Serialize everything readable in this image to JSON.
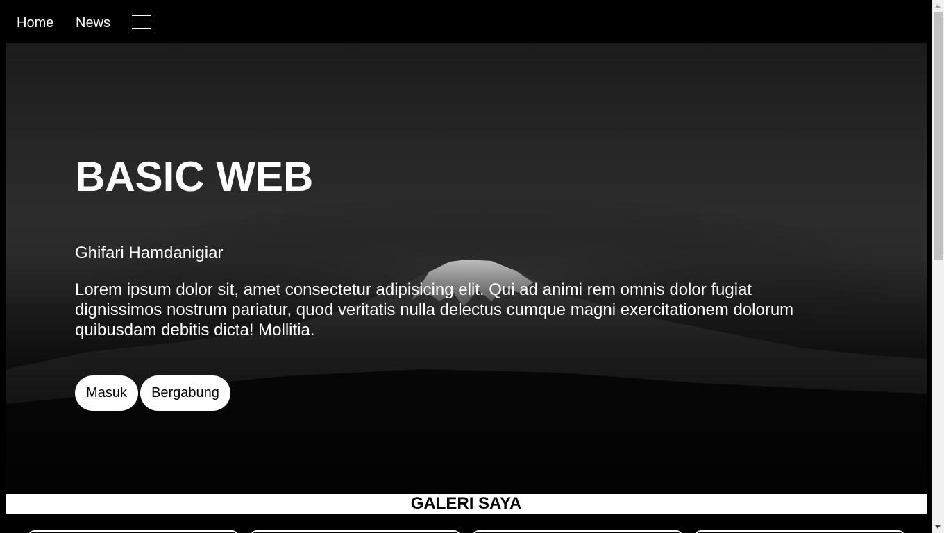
{
  "nav": {
    "home_label": "Home",
    "news_label": "News",
    "menu_icon": "hamburger-menu-icon"
  },
  "hero": {
    "title": "BASIC WEB",
    "subtitle": "Ghifari Hamdanigiar",
    "text": "Lorem ipsum dolor sit, amet consectetur adipisicing elit. Qui ad animi rem omnis dolor fugiat dignissimos nostrum pariatur, quod veritatis nulla delectus cumque magni exercitationem dolorum quibusdam debitis dicta! Mollitia.",
    "buttons": {
      "login_label": "Masuk",
      "join_label": "Bergabung"
    }
  },
  "gallery": {
    "title": "GALERI SAYA"
  },
  "colors": {
    "background": "#000000",
    "text": "#ffffff",
    "button_bg": "#ffffff",
    "button_text": "#000000"
  }
}
